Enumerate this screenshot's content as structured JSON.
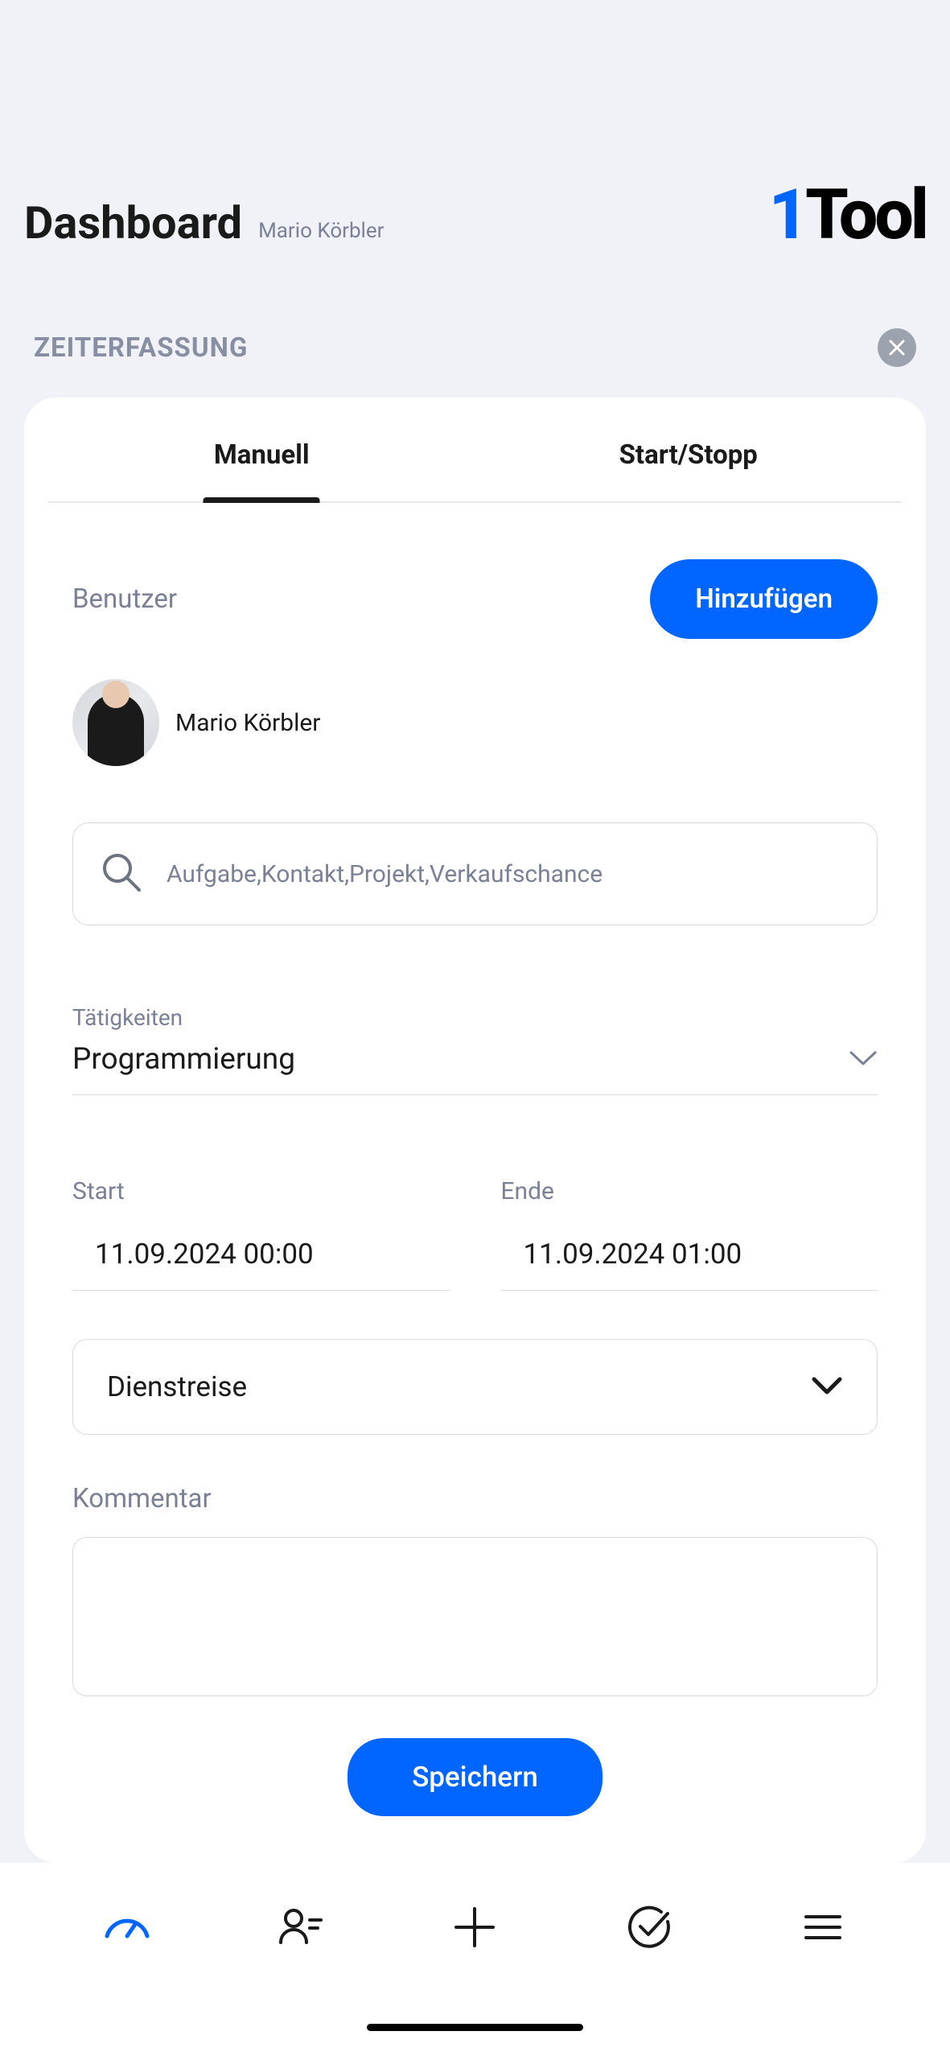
{
  "header": {
    "title": "Dashboard",
    "username": "Mario Körbler",
    "logo": {
      "one": "1",
      "tool": "Tool"
    }
  },
  "section": {
    "title": "ZEITERFASSUNG"
  },
  "tabs": {
    "manual": "Manuell",
    "startstop": "Start/Stopp"
  },
  "form": {
    "user_label": "Benutzer",
    "add_button": "Hinzufügen",
    "selected_user": "Mario Körbler",
    "search_placeholder": "Aufgabe,Kontakt,Projekt,Verkaufschance",
    "activity_label": "Tätigkeiten",
    "activity_value": "Programmierung",
    "start_label": "Start",
    "start_value": "11.09.2024 00:00",
    "end_label": "Ende",
    "end_value": "11.09.2024 01:00",
    "trip_value": "Dienstreise",
    "comment_label": "Kommentar",
    "save_button": "Speichern"
  }
}
